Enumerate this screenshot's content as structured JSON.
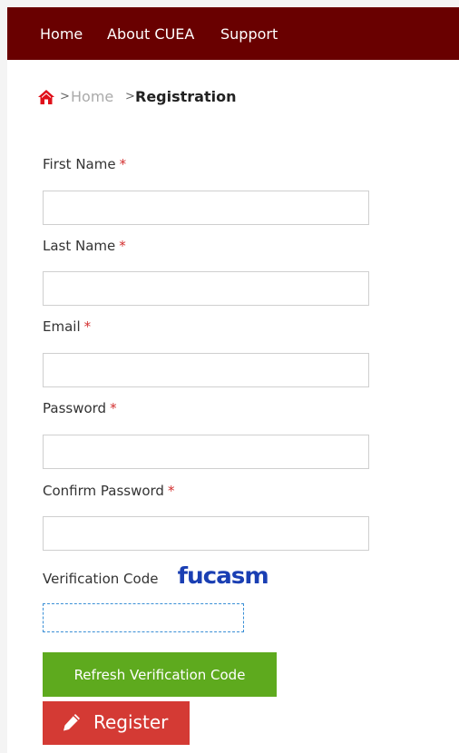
{
  "nav": {
    "items": [
      {
        "label": "Home"
      },
      {
        "label": "About CUEA"
      },
      {
        "label": "Support"
      }
    ],
    "background": "#690000"
  },
  "breadcrumb": {
    "home_icon": "home-icon",
    "home_icon_color": "#e0101a",
    "separator": ">",
    "home_label": "Home",
    "current_label": "Registration"
  },
  "form": {
    "required_marker": "*",
    "fields": {
      "first_name": {
        "label": "First Name",
        "value": ""
      },
      "last_name": {
        "label": "Last Name",
        "value": ""
      },
      "email": {
        "label": "Email",
        "value": ""
      },
      "password": {
        "label": "Password",
        "value": ""
      },
      "confirm_password": {
        "label": "Confirm Password",
        "value": ""
      }
    },
    "verification": {
      "label": "Verification Code",
      "captcha_text": "fucasm",
      "value": ""
    },
    "buttons": {
      "refresh_label": "Refresh Verification Code",
      "refresh_color": "#5eaa1e",
      "register_label": "Register",
      "register_icon": "pencil-icon",
      "register_color": "#d43a34"
    }
  }
}
